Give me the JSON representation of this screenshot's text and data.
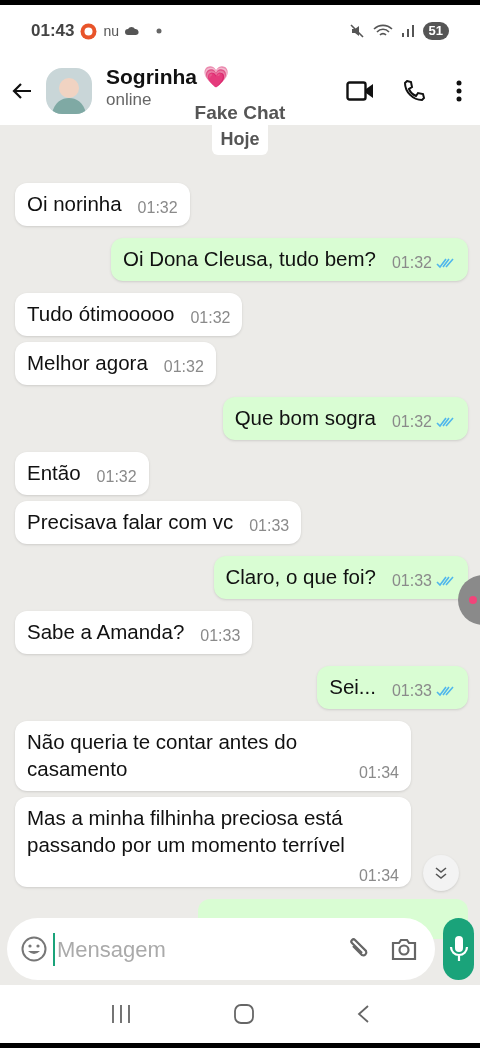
{
  "status_bar": {
    "time": "01:43",
    "notification_text": "nu",
    "battery": "51"
  },
  "header": {
    "name": "Sogrinha 💗",
    "status": "online",
    "overlay_label": "Fake Chat"
  },
  "date_chip": "Hoje",
  "messages": [
    {
      "kind": "in",
      "text": "Oi norinha",
      "time": "01:32"
    },
    {
      "kind": "out",
      "text": "Oi Dona Cleusa, tudo bem?",
      "time": "01:32",
      "read": true
    },
    {
      "kind": "in",
      "text": "Tudo ótimooooo",
      "time": "01:32"
    },
    {
      "kind": "in",
      "text": "Melhor agora",
      "time": "01:32"
    },
    {
      "kind": "out",
      "text": "Que bom sogra",
      "time": "01:32",
      "read": true
    },
    {
      "kind": "in",
      "text": "Então",
      "time": "01:32"
    },
    {
      "kind": "in",
      "text": "Precisava falar com vc",
      "time": "01:33"
    },
    {
      "kind": "out",
      "text": "Claro, o que foi?",
      "time": "01:33",
      "read": true
    },
    {
      "kind": "in",
      "text": "Sabe a Amanda?",
      "time": "01:33"
    },
    {
      "kind": "out",
      "text": "Sei...",
      "time": "01:33",
      "read": true
    },
    {
      "kind": "in",
      "text": "Não queria te contar antes do casamento",
      "time": "01:34"
    },
    {
      "kind": "in",
      "text": "Mas a minha filhinha preciosa está passando por um momento terrível",
      "time": "01:34"
    },
    {
      "kind": "cut"
    }
  ],
  "composer": {
    "placeholder": "Mensagem"
  }
}
